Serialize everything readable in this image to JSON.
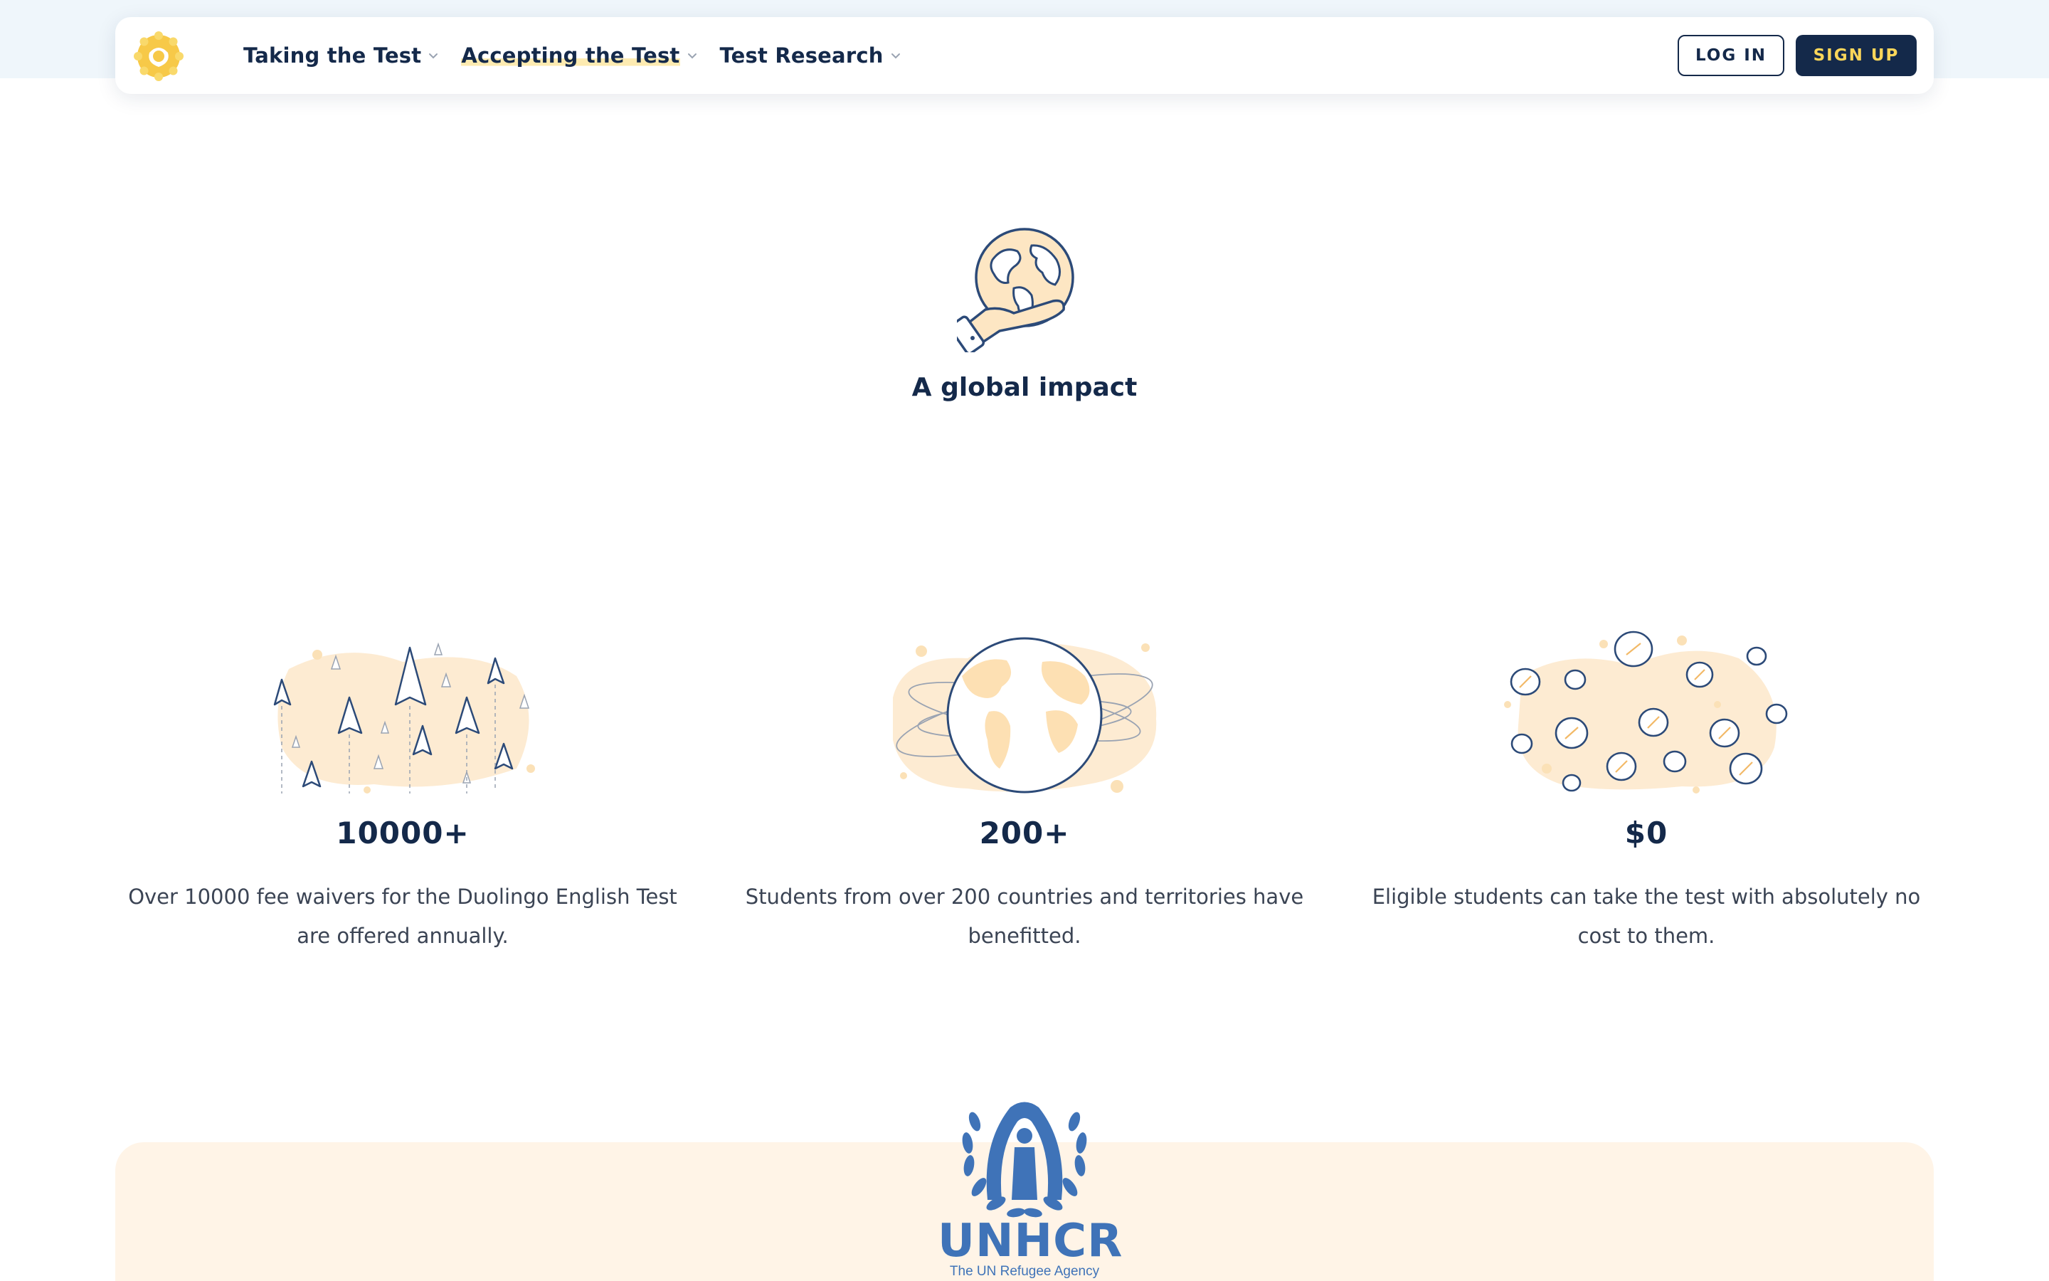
{
  "nav": {
    "items": [
      {
        "label": "Taking the Test"
      },
      {
        "label": "Accepting the Test"
      },
      {
        "label": "Test Research"
      }
    ],
    "login_label": "LOG IN",
    "signup_label": "SIGN UP"
  },
  "hero": {
    "title": "A global impact",
    "icon": "globe-in-hand-icon"
  },
  "stats": [
    {
      "value": "10000+",
      "description": "Over 10000 fee waivers for the Duolingo English Test are offered annually.",
      "icon": "paper-planes-illustration"
    },
    {
      "value": "200+",
      "description": "Students from over 200 countries and territories have benefitted.",
      "icon": "globe-orbit-illustration"
    },
    {
      "value": "$0",
      "description": "Eligible students can take the test with absolutely no cost to them.",
      "icon": "coins-illustration"
    }
  ],
  "partner": {
    "name": "UNHCR",
    "tagline": "The UN Refugee Agency"
  },
  "colors": {
    "navy": "#14294a",
    "yellow": "#fbd65a",
    "cream": "#fff4e7",
    "peach": "#fde6c3",
    "unhcr_blue": "#3f73b8"
  }
}
